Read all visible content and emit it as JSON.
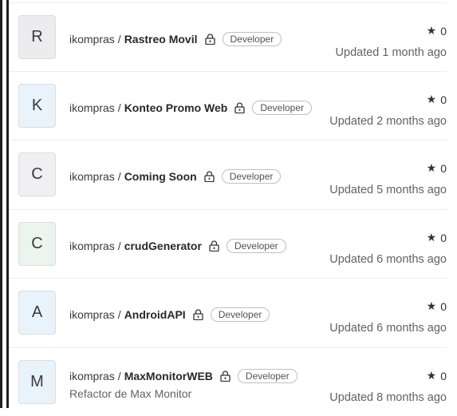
{
  "projects": [
    {
      "avatar_letter": "R",
      "namespace": "ikompras",
      "separator": "/",
      "name": "Rastreo Movil",
      "role": "Developer",
      "stars": "0",
      "updated": "Updated 1 month ago",
      "description": ""
    },
    {
      "avatar_letter": "K",
      "namespace": "ikompras",
      "separator": "/",
      "name": "Konteo Promo Web",
      "role": "Developer",
      "stars": "0",
      "updated": "Updated 2 months ago",
      "description": ""
    },
    {
      "avatar_letter": "C",
      "namespace": "ikompras",
      "separator": "/",
      "name": "Coming Soon",
      "role": "Developer",
      "stars": "0",
      "updated": "Updated 5 months ago",
      "description": ""
    },
    {
      "avatar_letter": "C",
      "namespace": "ikompras",
      "separator": "/",
      "name": "crudGenerator",
      "role": "Developer",
      "stars": "0",
      "updated": "Updated 6 months ago",
      "description": ""
    },
    {
      "avatar_letter": "A",
      "namespace": "ikompras",
      "separator": "/",
      "name": "AndroidAPI",
      "role": "Developer",
      "stars": "0",
      "updated": "Updated 6 months ago",
      "description": ""
    },
    {
      "avatar_letter": "M",
      "namespace": "ikompras",
      "separator": "/",
      "name": "MaxMonitorWEB",
      "role": "Developer",
      "stars": "0",
      "updated": "Updated 8 months ago",
      "description": "Refactor de Max Monitor"
    }
  ],
  "icons": {
    "star": "star-icon",
    "lock": "lock-icon"
  }
}
